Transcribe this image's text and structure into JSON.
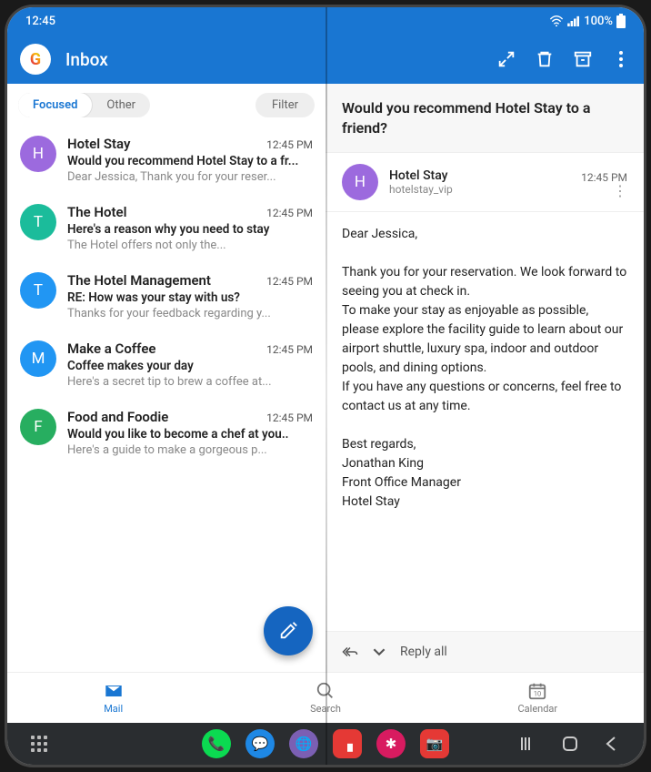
{
  "status": {
    "time": "12:45",
    "battery": "100%"
  },
  "header": {
    "title": "Inbox"
  },
  "tabs": {
    "focused": "Focused",
    "other": "Other",
    "filter": "Filter"
  },
  "emails": [
    {
      "avatar": "H",
      "color": "c-purple",
      "sender": "Hotel Stay",
      "time": "12:45 PM",
      "subject": "Would you recommend Hotel Stay to a fr...",
      "preview": "Dear Jessica, Thank you for your reser..."
    },
    {
      "avatar": "T",
      "color": "c-teal",
      "sender": "The Hotel",
      "time": "12:45 PM",
      "subject": "Here's a reason why you need to stay",
      "preview": "The Hotel offers not only the..."
    },
    {
      "avatar": "T",
      "color": "c-blue",
      "sender": "The Hotel Management",
      "time": "12:45 PM",
      "subject": "RE: How was your stay with us?",
      "preview": "Thanks for your feedback regarding y..."
    },
    {
      "avatar": "M",
      "color": "c-blue",
      "sender": "Make a Coffee",
      "time": "12:45 PM",
      "subject": "Coffee makes your day",
      "preview": "Here's a secret tip to brew a coffee at..."
    },
    {
      "avatar": "F",
      "color": "c-green",
      "sender": "Food and Foodie",
      "time": "12:45 PM",
      "subject": "Would you like to become a chef at you..",
      "preview": "Here's a guide to make a gorgeous p..."
    }
  ],
  "message": {
    "subject": "Would you recommend Hotel Stay to a friend?",
    "avatar": "H",
    "from_name": "Hotel Stay",
    "from_addr": "hotelstay_vip",
    "time": "12:45 PM",
    "body": "Dear Jessica,\n\nThank you for your reservation. We look forward to seeing you at check in.\nTo make your stay as enjoyable as possible, please explore the facility guide to learn about our airport shuttle, luxury spa, indoor and outdoor pools, and dining options.\nIf you have any questions or concerns, feel free to contact us at any time.\n\nBest regards,\nJonathan King\nFront Office Manager\nHotel Stay"
  },
  "reply": {
    "label": "Reply all"
  },
  "nav": {
    "mail": "Mail",
    "search": "Search",
    "calendar": "Calendar",
    "calendar_day": "10"
  }
}
